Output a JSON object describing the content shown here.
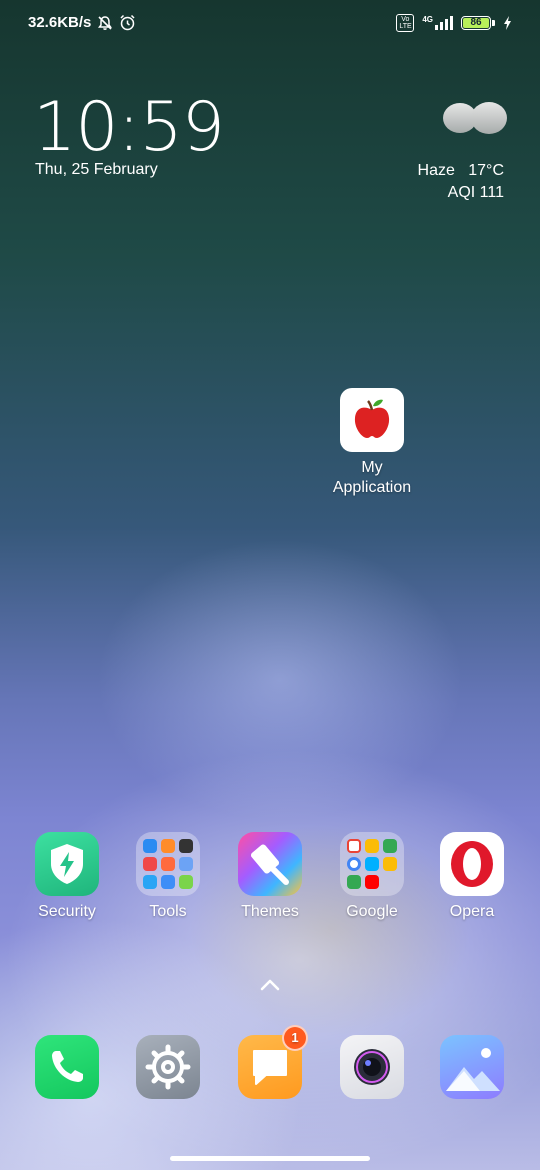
{
  "status_bar": {
    "net_speed": "32.6KB/s",
    "volte_label": "Vo LTE",
    "network_type": "4G",
    "battery_level": "86"
  },
  "clock_widget": {
    "time": "10:59",
    "date": "Thu, 25 February"
  },
  "weather_widget": {
    "condition": "Haze",
    "temperature": "17°C",
    "aqi": "AQI 111"
  },
  "home_apps": [
    {
      "label_line1": "My",
      "label_line2": "Application"
    }
  ],
  "app_row": [
    {
      "label": "Security"
    },
    {
      "label": "Tools"
    },
    {
      "label": "Themes"
    },
    {
      "label": "Google"
    },
    {
      "label": "Opera"
    }
  ],
  "dock": {
    "messages_badge": "1"
  },
  "colors": {
    "security_green": "#25c38a",
    "phone_green": "#17d36b",
    "messages_orange": "#ffa62b",
    "opera_red": "#e0182b",
    "battery_green": "#b8f05a"
  }
}
